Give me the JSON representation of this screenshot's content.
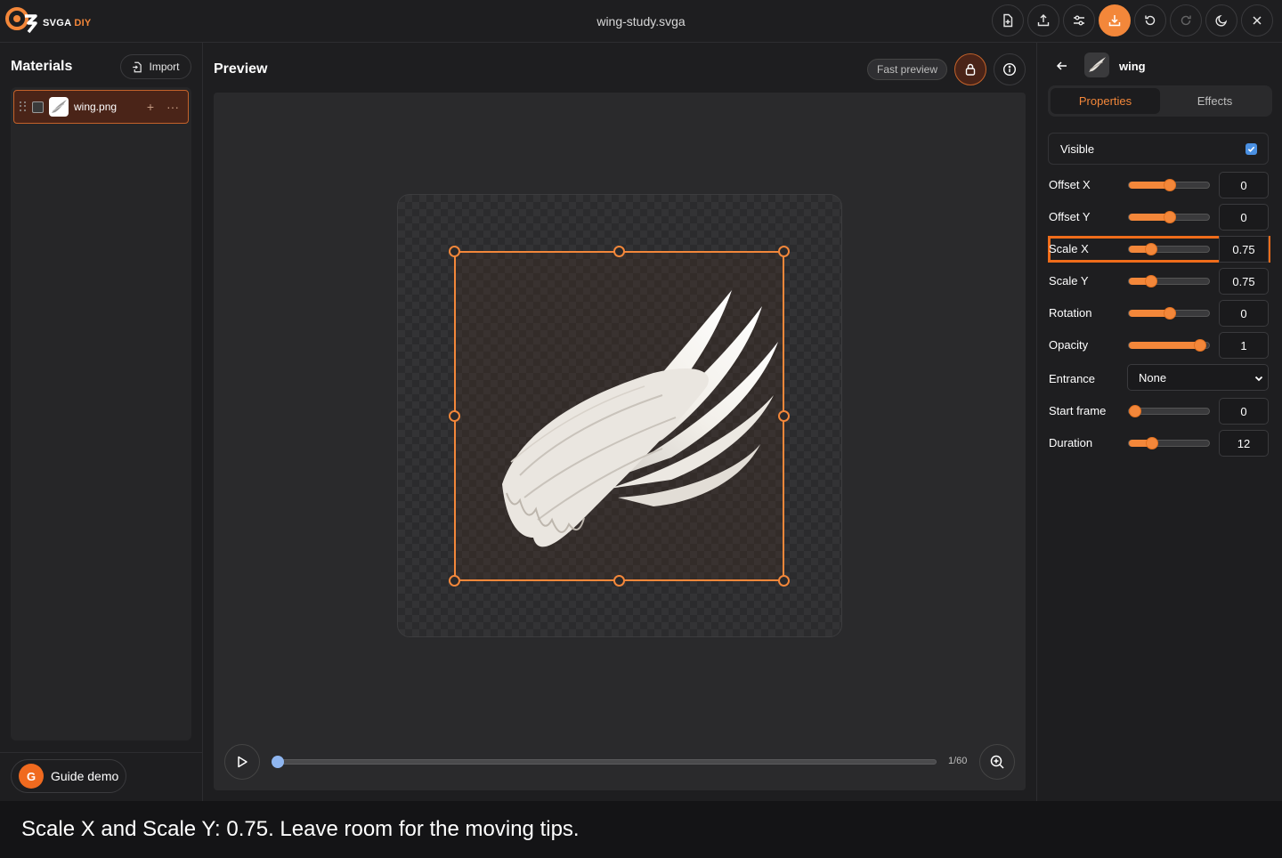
{
  "app": {
    "logo_text": "SVGA",
    "logo_accent": "DIY",
    "file_title": "wing-study.svga",
    "accent_color": "#f3873a"
  },
  "toolbar": {
    "buttons": [
      {
        "name": "new-file",
        "icon": "file-plus-icon"
      },
      {
        "name": "export",
        "icon": "upload-icon"
      },
      {
        "name": "settings",
        "icon": "sliders-icon"
      },
      {
        "name": "download",
        "icon": "download-icon"
      },
      {
        "name": "undo",
        "icon": "undo-icon"
      },
      {
        "name": "redo",
        "icon": "redo-icon"
      },
      {
        "name": "theme",
        "icon": "moon-icon"
      },
      {
        "name": "close",
        "icon": "close-icon"
      }
    ]
  },
  "materials": {
    "title": "Materials",
    "import_label": "Import",
    "items": [
      {
        "name": "wing.png",
        "selected": true
      }
    ],
    "add_glyph": "+",
    "more_glyph": "···"
  },
  "guide": {
    "avatar_letter": "G",
    "label": "Guide demo"
  },
  "preview": {
    "title": "Preview",
    "fast_preview_label": "Fast preview",
    "frame_counter": "1/60",
    "progress": 0.0
  },
  "layer": {
    "name": "wing",
    "tabs": [
      {
        "label": "Properties",
        "active": true
      },
      {
        "label": "Effects",
        "active": false
      }
    ],
    "visible_label": "Visible",
    "visible": true,
    "properties": [
      {
        "label": "Offset X",
        "value": "0",
        "fraction": 0.5
      },
      {
        "label": "Offset Y",
        "value": "0",
        "fraction": 0.5
      },
      {
        "label": "Scale X",
        "value": "0.75",
        "fraction": 0.23,
        "highlighted": true
      },
      {
        "label": "Scale Y",
        "value": "0.75",
        "fraction": 0.23
      },
      {
        "label": "Rotation",
        "value": "0",
        "fraction": 0.5
      },
      {
        "label": "Opacity",
        "value": "1",
        "fraction": 0.93
      }
    ],
    "entrance": {
      "label": "Entrance",
      "selected": "None"
    },
    "timing": [
      {
        "label": "Start frame",
        "value": "0",
        "fraction": 0.0
      },
      {
        "label": "Duration",
        "value": "12",
        "fraction": 0.24
      }
    ]
  },
  "caption": "Scale X and Scale Y: 0.75. Leave room for the moving tips."
}
